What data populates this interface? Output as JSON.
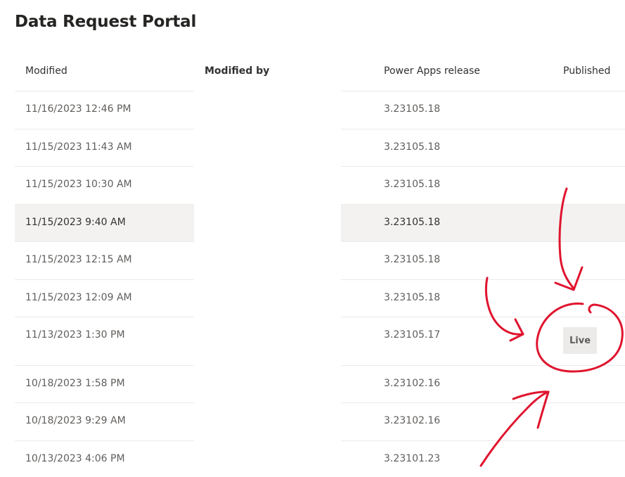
{
  "page": {
    "title": "Data Request Portal"
  },
  "table": {
    "columns": {
      "modified": "Modified",
      "modified_by": "Modified by",
      "release": "Power Apps release",
      "published": "Published"
    },
    "rows": [
      {
        "modified": "11/16/2023 12:46 PM",
        "modified_by": "",
        "release": "3.23105.18",
        "published": ""
      },
      {
        "modified": "11/15/2023 11:43 AM",
        "modified_by": "",
        "release": "3.23105.18",
        "published": ""
      },
      {
        "modified": "11/15/2023 10:30 AM",
        "modified_by": "",
        "release": "3.23105.18",
        "published": ""
      },
      {
        "modified": "11/15/2023 9:40 AM",
        "modified_by": "",
        "release": "3.23105.18",
        "published": "",
        "selected": true
      },
      {
        "modified": "11/15/2023 12:15 AM",
        "modified_by": "",
        "release": "3.23105.18",
        "published": ""
      },
      {
        "modified": "11/15/2023 12:09 AM",
        "modified_by": "",
        "release": "3.23105.18",
        "published": ""
      },
      {
        "modified": "11/13/2023 1:30 PM",
        "modified_by": "",
        "release": "3.23105.17",
        "published": "Live"
      },
      {
        "modified": "10/18/2023 1:58 PM",
        "modified_by": "",
        "release": "3.23102.16",
        "published": ""
      },
      {
        "modified": "10/18/2023 9:29 AM",
        "modified_by": "",
        "release": "3.23102.16",
        "published": ""
      },
      {
        "modified": "10/13/2023 4:06 PM",
        "modified_by": "",
        "release": "3.23101.23",
        "published": ""
      }
    ]
  },
  "annotation": {
    "color": "#e0142e"
  }
}
